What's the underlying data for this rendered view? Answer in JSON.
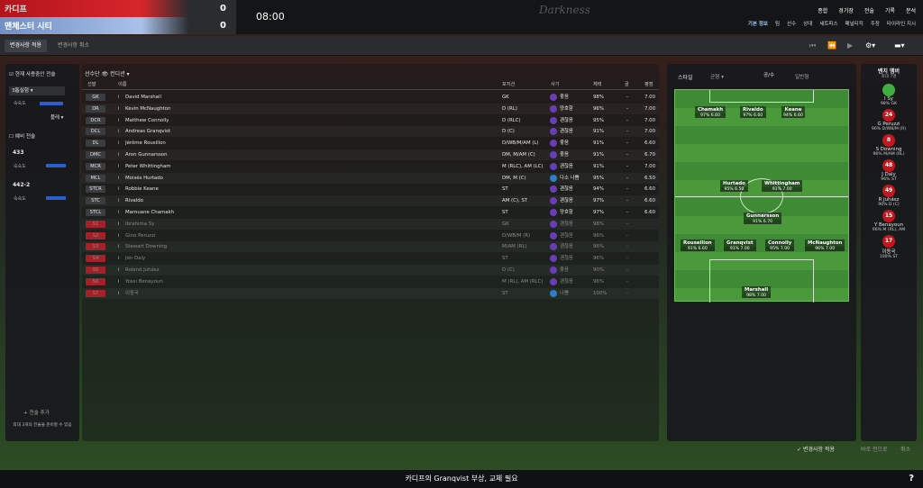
{
  "header": {
    "home_team": "카디프",
    "away_team": "맨체스터 시티",
    "home_score": "0",
    "away_score": "0",
    "clock": "08:00",
    "logo": "Darkness",
    "nav": [
      "종합",
      "경기장",
      "전술",
      "기록",
      "분석"
    ],
    "subnav": [
      "기본 정보",
      "팀",
      "선수",
      "상대",
      "세트피스",
      "패널티킥",
      "주장",
      "타이라인 지시"
    ]
  },
  "toolbar": {
    "apply": "변경사항 적용",
    "cancel": "변경사항 취소"
  },
  "left": {
    "current_tactic": "현재 사용중인 전술",
    "tactic_name": "3톱실험",
    "familiarity": "숙숙도",
    "play_label": "플레",
    "reserve": "예비 전술",
    "t433": "433",
    "t4422": "442-2",
    "add": "+ 전술 추가",
    "note": "최대 3개의 전술을 준비할 수 있음"
  },
  "squad": {
    "squad_label": "선수단",
    "view_label": "컨디션",
    "columns": [
      "선발",
      "이름",
      "포지션",
      "사기",
      "체력",
      "골",
      "평점"
    ],
    "rows": [
      {
        "pos": "GK",
        "name": "David Marshall",
        "position": "GK",
        "morale": "좋음",
        "cond": "98%",
        "goals": "-",
        "rating": "7.00",
        "sub": false
      },
      {
        "pos": "DR",
        "name": "Kevin McNaughton",
        "position": "D (RL)",
        "morale": "양호함",
        "cond": "96%",
        "goals": "-",
        "rating": "7.00",
        "sub": false
      },
      {
        "pos": "DCR",
        "name": "Matthew Connolly",
        "position": "D (RLC)",
        "morale": "괜찮음",
        "cond": "95%",
        "goals": "-",
        "rating": "7.00",
        "sub": false
      },
      {
        "pos": "DCL",
        "name": "Andreas Granqvist",
        "position": "D (C)",
        "morale": "괜찮음",
        "cond": "91%",
        "goals": "-",
        "rating": "7.00",
        "sub": false
      },
      {
        "pos": "DL",
        "name": "Jérôme Rousillon",
        "position": "D/WB/M/AM (L)",
        "morale": "좋음",
        "cond": "91%",
        "goals": "-",
        "rating": "6.60",
        "sub": false
      },
      {
        "pos": "DMC",
        "name": "Aron Gunnarsson",
        "position": "DM, M/AM (C)",
        "morale": "좋음",
        "cond": "91%",
        "goals": "-",
        "rating": "6.70",
        "sub": false
      },
      {
        "pos": "MCR",
        "name": "Peter Whittingham",
        "position": "M (RLC), AM (LC)",
        "morale": "괜찮음",
        "cond": "91%",
        "goals": "-",
        "rating": "7.00",
        "sub": false
      },
      {
        "pos": "MCL",
        "name": "Moisés Hurtado",
        "position": "DM, M (C)",
        "morale": "다소 나쁨",
        "cond": "95%",
        "goals": "-",
        "rating": "6.50",
        "sub": false
      },
      {
        "pos": "STCR",
        "name": "Robbie Keane",
        "position": "ST",
        "morale": "괜찮음",
        "cond": "94%",
        "goals": "-",
        "rating": "6.60",
        "sub": false
      },
      {
        "pos": "STC",
        "name": "Rivaldo",
        "position": "AM (C), ST",
        "morale": "괜찮음",
        "cond": "97%",
        "goals": "-",
        "rating": "6.60",
        "sub": false
      },
      {
        "pos": "STCL",
        "name": "Marouane Chamakh",
        "position": "ST",
        "morale": "양호함",
        "cond": "97%",
        "goals": "-",
        "rating": "6.60",
        "sub": false
      },
      {
        "pos": "S1",
        "name": "Ibrahima Sy",
        "position": "GK",
        "morale": "괜찮음",
        "cond": "98%",
        "goals": "-",
        "rating": "",
        "sub": true
      },
      {
        "pos": "S2",
        "name": "Gino Peruzzi",
        "position": "D/WB/M (R)",
        "morale": "괜찮음",
        "cond": "96%",
        "goals": "-",
        "rating": "",
        "sub": true
      },
      {
        "pos": "S3",
        "name": "Stewart Downing",
        "position": "M/AM (RL)",
        "morale": "괜찮음",
        "cond": "96%",
        "goals": "-",
        "rating": "",
        "sub": true
      },
      {
        "pos": "S4",
        "name": "Jon Daly",
        "position": "ST",
        "morale": "괜찮음",
        "cond": "96%",
        "goals": "-",
        "rating": "",
        "sub": true
      },
      {
        "pos": "S5",
        "name": "Roland Juhász",
        "position": "D (C)",
        "morale": "좋음",
        "cond": "90%",
        "goals": "-",
        "rating": "",
        "sub": true
      },
      {
        "pos": "S6",
        "name": "Yossi Benayoun",
        "position": "M (RL), AM (RLC)",
        "morale": "괜찮음",
        "cond": "96%",
        "goals": "-",
        "rating": "",
        "sub": true
      },
      {
        "pos": "S7",
        "name": "이동국",
        "position": "ST",
        "morale": "나쁨",
        "cond": "100%",
        "goals": "-",
        "rating": "",
        "sub": true
      }
    ]
  },
  "pitch": {
    "style": "스타일",
    "balance": "균형",
    "atk": "공/수",
    "normal": "일반형",
    "players": [
      {
        "name": "Chamakh",
        "stats": "97% 6.60"
      },
      {
        "name": "Rivaldo",
        "stats": "97% 6.60"
      },
      {
        "name": "Keane",
        "stats": "94% 6.60"
      },
      {
        "name": "Hurtado",
        "stats": "95% 6.50"
      },
      {
        "name": "Whittingham",
        "stats": "91% 7.00"
      },
      {
        "name": "Gunnarsson",
        "stats": "91% 6.70"
      },
      {
        "name": "Rousellion",
        "stats": "91% 6.60"
      },
      {
        "name": "Granqvist",
        "stats": "91% 7.00"
      },
      {
        "name": "Connolly",
        "stats": "95% 7.00"
      },
      {
        "name": "McNaughton",
        "stats": "96% 7.00"
      },
      {
        "name": "Marshall",
        "stats": "98% 7.00"
      }
    ]
  },
  "bench": {
    "title": "벤치 멤버",
    "max": "최대 7명",
    "items": [
      {
        "num": "",
        "name": "I Sy",
        "stats": "98% GK"
      },
      {
        "num": "24",
        "name": "G Peruzzi",
        "stats": "96% D/WB/M (R)"
      },
      {
        "num": "8",
        "name": "S Downing",
        "stats": "96% M/AM (RL)"
      },
      {
        "num": "48",
        "name": "J Daly",
        "stats": "96% ST"
      },
      {
        "num": "49",
        "name": "R Juhász",
        "stats": "90% D (C)"
      },
      {
        "num": "15",
        "name": "Y Benayoun",
        "stats": "96% M (RL), AM"
      },
      {
        "num": "17",
        "name": "이동국",
        "stats": "100% ST"
      }
    ]
  },
  "bottom": {
    "apply": "변경사항 적용",
    "reset": "바로 전으로",
    "cancel": "취소"
  },
  "footer": {
    "message": "카디프의 Granqvist 부상, 교체 필요"
  }
}
